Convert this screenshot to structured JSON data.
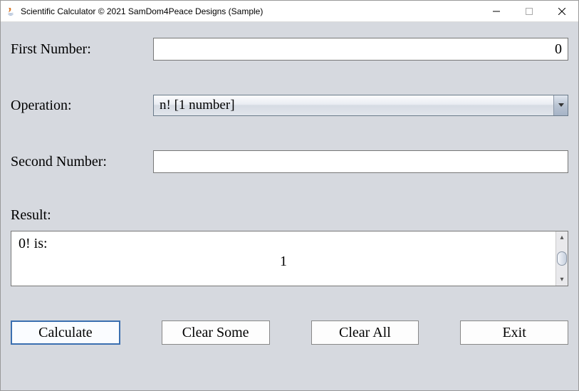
{
  "window": {
    "title": "Scientific Calculator © 2021 SamDom4Peace Designs (Sample)"
  },
  "form": {
    "first_label": "First Number:",
    "first_value": "0",
    "operation_label": "Operation:",
    "operation_value": "n! [1 number]",
    "second_label": "Second Number:",
    "second_value": "",
    "result_label": "Result:",
    "result_line1": "0! is:",
    "result_line2": "1"
  },
  "buttons": {
    "calculate": "Calculate",
    "clear_some": "Clear Some",
    "clear_all": "Clear All",
    "exit": "Exit"
  }
}
